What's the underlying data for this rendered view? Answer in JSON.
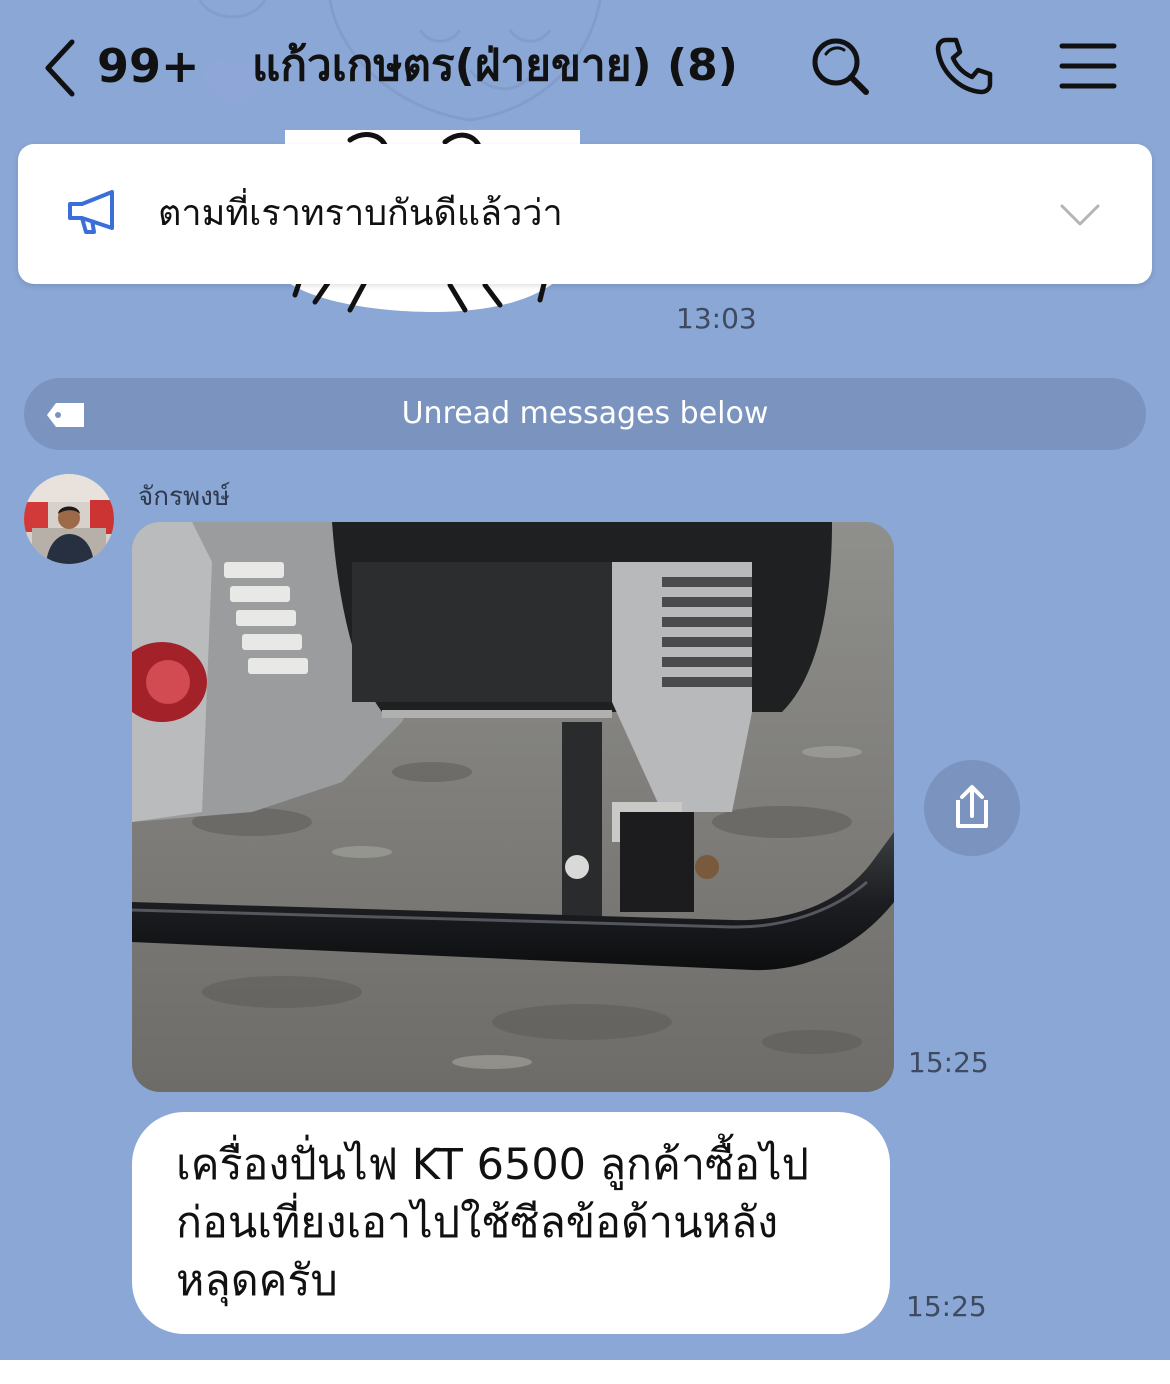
{
  "header": {
    "back_icon": "chevron-left-icon",
    "unread_count": "99+",
    "title": "แก้วเกษตร(ฝ่ายขาย) (8)",
    "search_icon": "search-icon",
    "call_icon": "phone-icon",
    "menu_icon": "menu-icon"
  },
  "announcement": {
    "icon": "megaphone-icon",
    "text": "ตามที่เราทราบกันดีแล้วว่า",
    "expand_icon": "chevron-down-icon"
  },
  "earlier_message": {
    "time": "13:03"
  },
  "unread_divider": {
    "icon": "tag-icon",
    "text": "Unread messages below"
  },
  "messages": [
    {
      "sender": "จักรพงษ์",
      "type": "image",
      "image_description": "photo of a generator's base mount and frame",
      "share_icon": "share-icon",
      "time": "15:25"
    },
    {
      "type": "text",
      "lines": [
        "เครื่องปั่นไฟ KT 6500 ลูกค้าซื้อไป",
        "ก่อนเที่ยงเอาไปใช้ซีลข้อด้านหลัง",
        "หลุดครับ"
      ],
      "time": "15:25"
    }
  ],
  "colors": {
    "background": "#8aa7d6",
    "divider": "#7a93bf",
    "bubble": "#ffffff",
    "accent_icon": "#3b6fd8"
  }
}
